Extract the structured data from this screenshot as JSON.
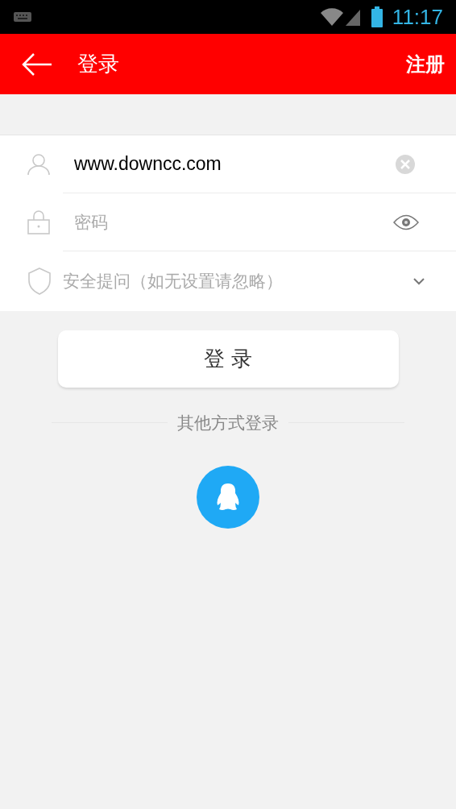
{
  "status_bar": {
    "time": "11:17"
  },
  "header": {
    "title": "登录",
    "action": "注册"
  },
  "form": {
    "username": {
      "value": "www.downcc.com"
    },
    "password": {
      "placeholder": "密码"
    },
    "security_question": {
      "placeholder": "安全提问（如无设置请忽略）"
    }
  },
  "login_button": "登 录",
  "other_login": {
    "label": "其他方式登录"
  }
}
